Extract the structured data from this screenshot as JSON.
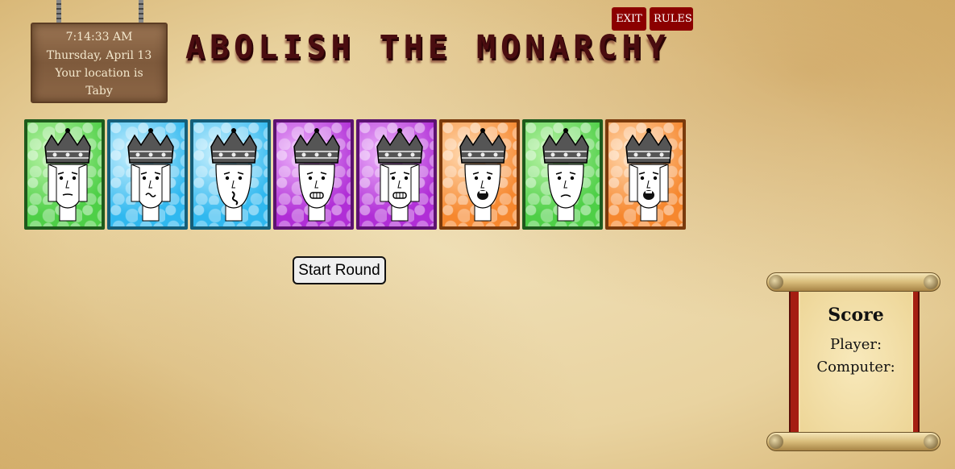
{
  "clock": {
    "time": "7:14:33 AM",
    "date": "Thursday, April 13",
    "location_prefix": "Your location is",
    "location": "Taby"
  },
  "title": "ABOLISH THE MONARCHY",
  "top_buttons": {
    "exit": "EXIT",
    "rules": "RULES"
  },
  "cards": [
    {
      "color": "green",
      "face": "neutral-long-hair"
    },
    {
      "color": "blue",
      "face": "squiggle-mouth-long-hair"
    },
    {
      "color": "blue",
      "face": "scribble-mouth"
    },
    {
      "color": "purple",
      "face": "teeth-grit"
    },
    {
      "color": "purple",
      "face": "teeth-grit-long-hair"
    },
    {
      "color": "orange",
      "face": "open-mouth-shout"
    },
    {
      "color": "green",
      "face": "frown"
    },
    {
      "color": "orange",
      "face": "open-mouth-long-hair"
    }
  ],
  "start_button": "Start Round",
  "score": {
    "title": "Score",
    "player_label": "Player:",
    "computer_label": "Computer:"
  },
  "colors": {
    "button_red": "#8b0000",
    "title_color": "#4a0d10",
    "card_green": "#4ecf47",
    "card_blue": "#30b8ef",
    "card_purple": "#b02ed6",
    "card_orange": "#f6872e"
  }
}
